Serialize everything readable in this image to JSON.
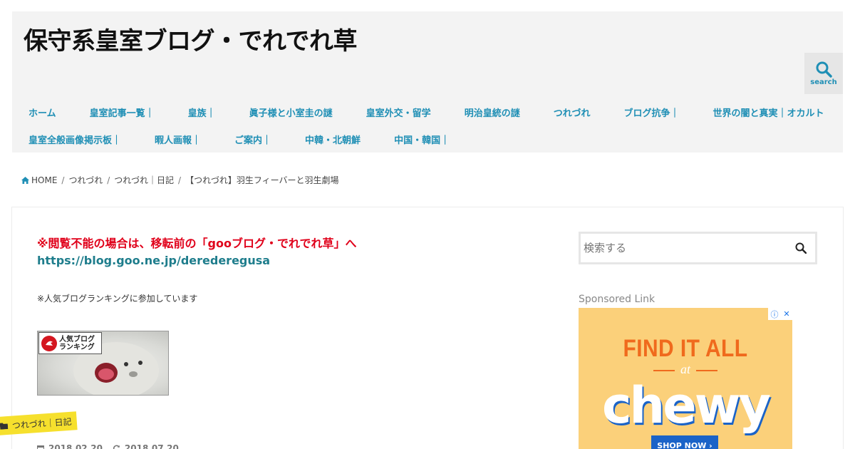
{
  "header": {
    "site_title": "保守系皇室ブログ・でれでれ草",
    "search_label": "search",
    "nav_row1": [
      "ホーム",
      "皇室記事一覧｜",
      "皇族｜",
      "眞子様と小室圭の謎",
      "皇室外交・留学",
      "明治皇統の謎",
      "つれづれ",
      "ブログ抗争｜",
      "世界の闇と真実｜オカルト"
    ],
    "nav_row2": [
      "皇室全般画像掲示板｜",
      "暇人画報｜",
      "ご案内｜",
      "中韓・北朝鮮",
      "中国・韓国｜"
    ]
  },
  "breadcrumb": {
    "home": "HOME",
    "level1": "つれづれ",
    "level2": "つれづれ｜日記",
    "current": "【つれづれ】羽生フィーバーと羽生劇場",
    "separator": "/"
  },
  "article": {
    "notice_text": "※閲覧不能の場合は、移転前の「gooブログ・でれでれ草」へ",
    "notice_link": "https://blog.goo.ne.jp/derederegusa",
    "ranking_note": "※人気ブログランキングに参加しています",
    "ranking_banner_line1": "人気ブログ",
    "ranking_banner_line2": "ランキング",
    "category_tag": "つれづれ｜日記",
    "date_published": "2018.02.20",
    "date_updated": "2018.07.20"
  },
  "sidebar": {
    "search_placeholder": "検索する",
    "sponsored_label": "Sponsored Link",
    "ad": {
      "headline": "FIND IT ALL",
      "at": "at",
      "brand": "chewy",
      "cta": "SHOP NOW ›",
      "info": "ⓘ",
      "close": "✕"
    }
  },
  "colors": {
    "accent": "#1f8fb5",
    "notice_red": "#e0001a",
    "tag_yellow": "#f6e02d",
    "ad_bg": "#fbd07a"
  }
}
